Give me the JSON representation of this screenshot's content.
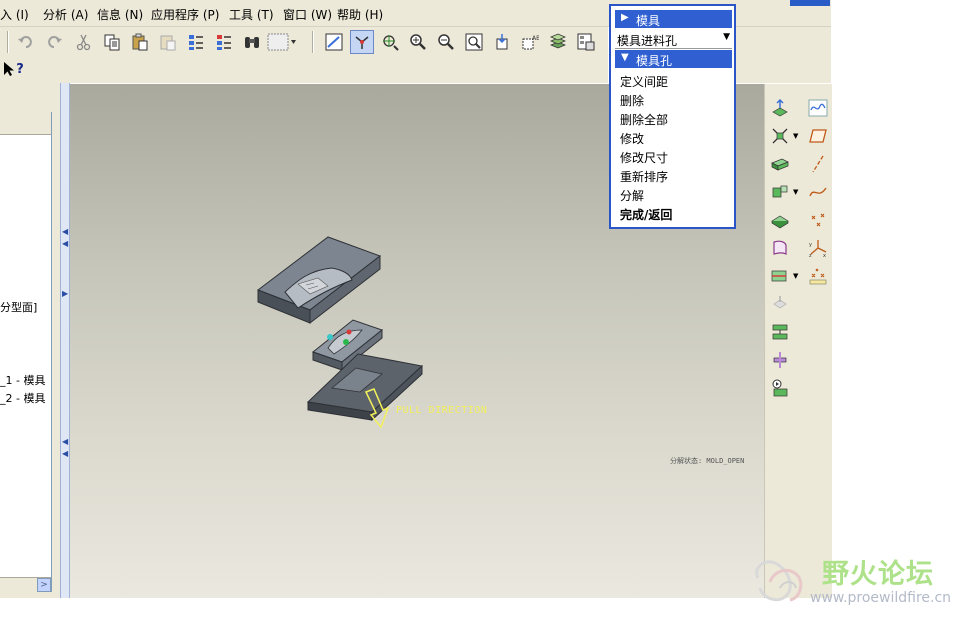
{
  "menubar": {
    "items": [
      {
        "label": "入 (I)"
      },
      {
        "label": "分析 (A)"
      },
      {
        "label": "信息 (N)"
      },
      {
        "label": "应用程序 (P)"
      },
      {
        "label": "工具 (T)"
      },
      {
        "label": "窗口 (W)"
      },
      {
        "label": "帮助 (H)"
      }
    ]
  },
  "toolbar2": {
    "context_help_label": "?"
  },
  "model_tree": {
    "rows": [
      {
        "label": "分型面]"
      },
      {
        "label": "_1 - 模具"
      },
      {
        "label": "_2 - 模具"
      }
    ],
    "scroll_arrow": ">"
  },
  "viewport": {
    "pull_direction_label": "PULL DIRECTION",
    "view_name_label": "分解状态: MOLD_OPEN"
  },
  "menu_manager": {
    "header_mold": "模具",
    "dropdown_value": "模具进料孔",
    "header_submenu": "模具孔",
    "items": [
      {
        "label": "定义间距"
      },
      {
        "label": "删除"
      },
      {
        "label": "删除全部"
      },
      {
        "label": "修改"
      },
      {
        "label": "修改尺寸"
      },
      {
        "label": "重新排序"
      },
      {
        "label": "分解"
      },
      {
        "label": "完成/返回"
      }
    ]
  },
  "watermark": {
    "title": "野火论坛",
    "url": "www.proewildfire.cn"
  },
  "colors": {
    "menu_header_blue": "#2f5fd0",
    "pull_direction_yellow": "#f2f05a",
    "watermark_green": "#aee28a"
  }
}
